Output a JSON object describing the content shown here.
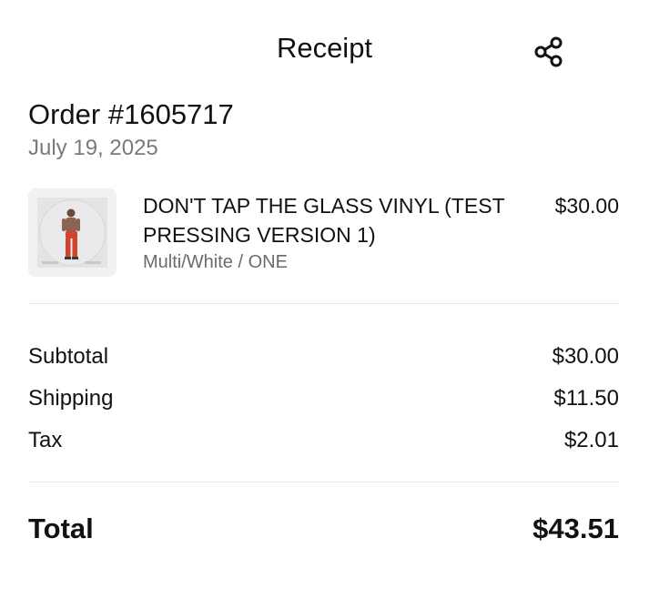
{
  "header": {
    "title": "Receipt"
  },
  "order": {
    "number_label": "Order #1605717",
    "date": "July 19, 2025"
  },
  "item": {
    "name": "DON'T TAP THE GLASS VINYL (TEST PRESSING VERSION 1)",
    "price": "$30.00",
    "variant": "Multi/White / ONE"
  },
  "summary": {
    "rows": [
      {
        "label": "Subtotal",
        "value": "$30.00"
      },
      {
        "label": "Shipping",
        "value": "$11.50"
      },
      {
        "label": "Tax",
        "value": "$2.01"
      }
    ],
    "total_label": "Total",
    "total_value": "$43.51"
  },
  "icons": {
    "share": "share-icon"
  },
  "colors": {
    "text": "#111111",
    "secondary": "#7a7a7a",
    "divider": "#e6e6e6",
    "thumb_bg": "#f1f1f1",
    "figure_pants": "#d0452c"
  }
}
